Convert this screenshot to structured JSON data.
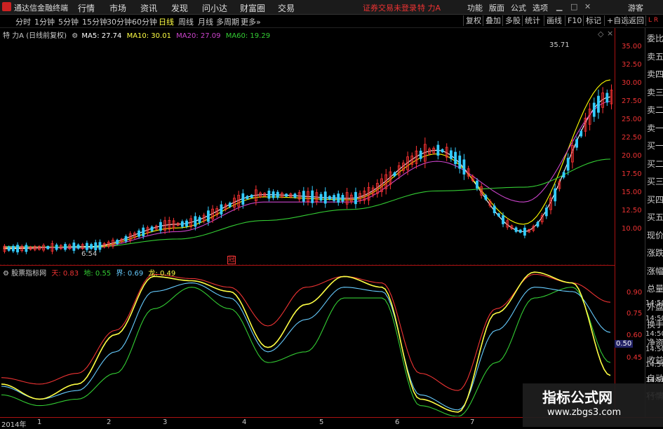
{
  "menubar": {
    "app_name": "通达信金融终端",
    "menus": [
      "行情",
      "市场",
      "资讯",
      "发现",
      "问小达",
      "财富圈",
      "交易"
    ],
    "warning": "证券交易未登录",
    "stock": "特 力A",
    "right": [
      "功能",
      "版面",
      "公式",
      "选项"
    ],
    "user": "游客"
  },
  "periodbar": {
    "periods": [
      "分时",
      "1分钟",
      "5分钟",
      "15分钟",
      "30分钟",
      "60分钟",
      "日线",
      "周线",
      "月线",
      "多周期",
      "更多»"
    ],
    "active": "日线",
    "tools": [
      "复权",
      "叠加",
      "多股",
      "统计",
      "画线",
      "F10",
      "标记",
      "+自选",
      "返回"
    ]
  },
  "main_legend": {
    "title": "特 力A (日线前复权)",
    "ma5": "MA5: 27.74",
    "ma10": "MA10: 30.01",
    "ma20": "MA20: 27.09",
    "ma60": "MA60: 19.29"
  },
  "annotations": {
    "high": "35.71",
    "low": "6.54",
    "mark": "冠"
  },
  "price_axis": [
    "35.00",
    "32.50",
    "30.00",
    "27.50",
    "25.00",
    "22.50",
    "20.00",
    "17.50",
    "15.00",
    "12.50",
    "10.00"
  ],
  "sub_legend": {
    "title": "股票指标网",
    "tian": "天: 0.83",
    "di": "地: 0.55",
    "jie": "界: 0.69",
    "long": "龙: 0.49"
  },
  "sub_axis": [
    "0.90",
    "0.75",
    "0.60",
    "0.45"
  ],
  "sub_axis_time": [
    "14:50",
    "14:50",
    "14:50",
    "14:50",
    "14:50",
    "14:50",
    "14:50"
  ],
  "sub_current": "0.50",
  "right_panel": [
    "委比",
    "卖五",
    "卖四",
    "卖三",
    "卖二",
    "卖一",
    "买一",
    "买二",
    "买三",
    "买四",
    "买五",
    "现价",
    "涨跌",
    "涨幅",
    "总量",
    "外盘",
    "换手",
    "净资",
    "收益",
    "自动",
    "行情"
  ],
  "bottom_axis": [
    "2014年",
    "1",
    "2",
    "3",
    "4",
    "5",
    "6",
    "7"
  ],
  "watermark": {
    "line1": "指标公式网",
    "line2": "www.zbgs3.com"
  },
  "colors": {
    "up": "#ff3333",
    "down": "#33ccff",
    "ma5": "#ffffff",
    "ma10": "#ffff00",
    "ma20": "#cc44cc",
    "ma60": "#33cc33"
  },
  "chart_data": [
    {
      "type": "line",
      "title": "特 力A (日线前复权)",
      "ylim": [
        5,
        37
      ],
      "x": [
        "2014-01",
        "2014-02",
        "2014-03",
        "2014-04",
        "2014-05",
        "2014-06",
        "2014-07",
        "2014-08"
      ],
      "series": [
        {
          "name": "MA5",
          "values": [
            7.2,
            7.5,
            10.5,
            14.5,
            14.0,
            20.5,
            9.5,
            27.7
          ]
        },
        {
          "name": "MA10",
          "values": [
            7.3,
            7.4,
            10.0,
            14.2,
            13.8,
            20.0,
            10.5,
            30.0
          ]
        },
        {
          "name": "MA20",
          "values": [
            7.4,
            7.3,
            9.5,
            13.5,
            13.5,
            19.0,
            13.5,
            27.1
          ]
        },
        {
          "name": "MA60",
          "values": [
            7.5,
            7.4,
            8.5,
            11.0,
            12.5,
            15.0,
            15.5,
            19.3
          ]
        }
      ]
    },
    {
      "type": "line",
      "title": "股票指标网",
      "ylim": [
        0.3,
        1.0
      ],
      "series": [
        {
          "name": "天",
          "values": [
            0.48,
            0.45,
            0.5,
            0.7,
            0.96,
            0.94,
            0.9,
            0.72,
            0.9,
            0.95,
            0.92,
            0.5,
            0.42,
            0.8,
            0.96,
            0.92,
            0.83
          ]
        },
        {
          "name": "地",
          "values": [
            0.4,
            0.35,
            0.38,
            0.5,
            0.8,
            0.9,
            0.8,
            0.55,
            0.6,
            0.85,
            0.85,
            0.35,
            0.3,
            0.55,
            0.85,
            0.9,
            0.55
          ]
        },
        {
          "name": "界",
          "values": [
            0.44,
            0.38,
            0.42,
            0.6,
            0.88,
            0.92,
            0.85,
            0.6,
            0.75,
            0.9,
            0.88,
            0.4,
            0.33,
            0.7,
            0.9,
            0.88,
            0.69
          ]
        },
        {
          "name": "龙",
          "values": [
            0.45,
            0.38,
            0.45,
            0.68,
            0.95,
            0.93,
            0.88,
            0.62,
            0.82,
            0.95,
            0.9,
            0.38,
            0.32,
            0.78,
            0.97,
            0.92,
            0.49
          ]
        }
      ]
    }
  ]
}
